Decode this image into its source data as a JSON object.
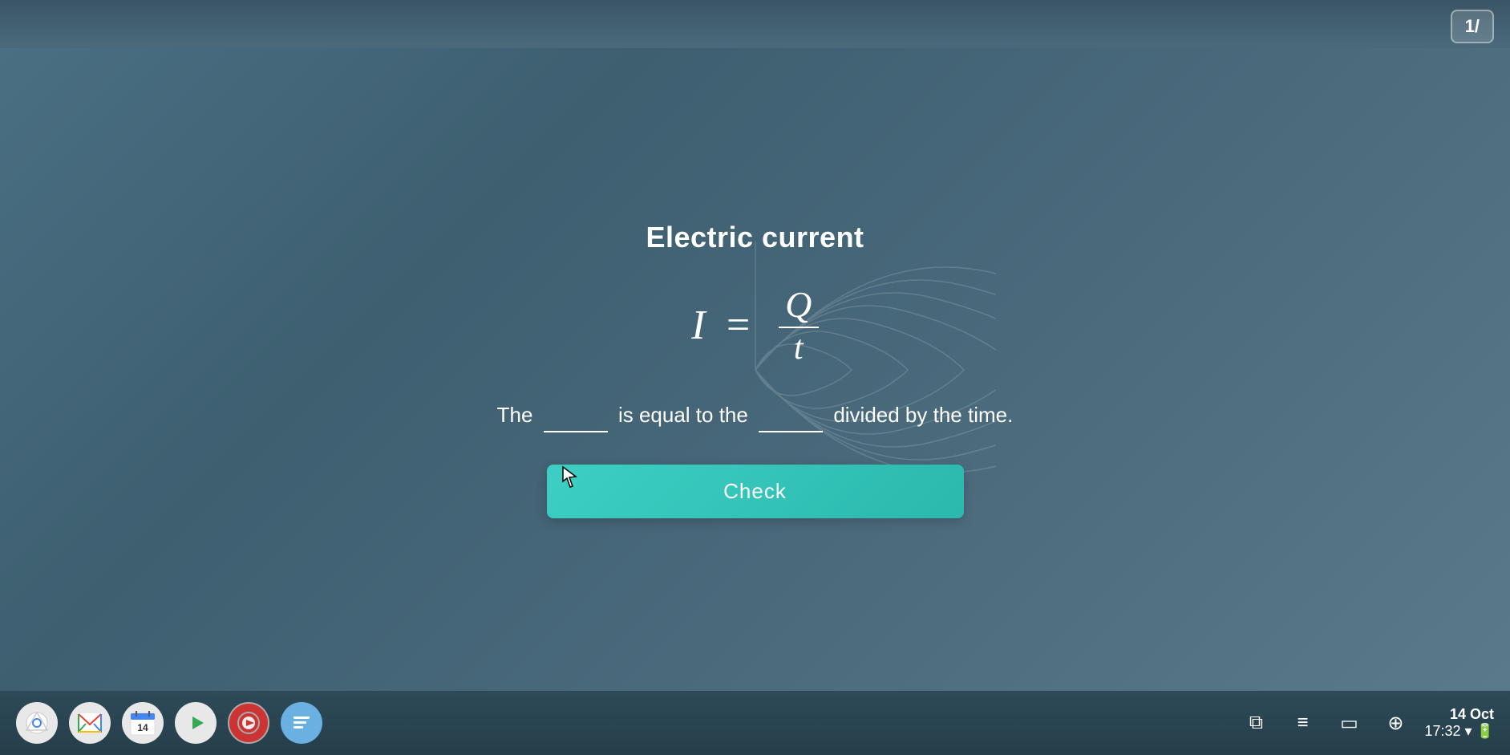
{
  "header": {
    "page_counter": "1/"
  },
  "main": {
    "title": "Electric current",
    "formula": {
      "i": "I",
      "equals": "=",
      "numerator": "Q",
      "denominator": "t"
    },
    "question": {
      "part1": "The",
      "blank1": "",
      "part2": "is equal to the",
      "blank2": "",
      "part3": "divided by the time."
    },
    "check_button": "Check"
  },
  "taskbar": {
    "icons": [
      {
        "name": "chrome",
        "symbol": "⊙"
      },
      {
        "name": "gmail",
        "symbol": "M"
      },
      {
        "name": "calendar",
        "symbol": "▦"
      },
      {
        "name": "drive",
        "symbol": "▷"
      },
      {
        "name": "meet",
        "symbol": "✔"
      },
      {
        "name": "media",
        "symbol": "▶"
      }
    ],
    "system": {
      "screenshot": "⧉",
      "tasks": "≡",
      "display": "▭",
      "settings": "⊕"
    },
    "date": "14 Oct",
    "time": "17:32"
  }
}
